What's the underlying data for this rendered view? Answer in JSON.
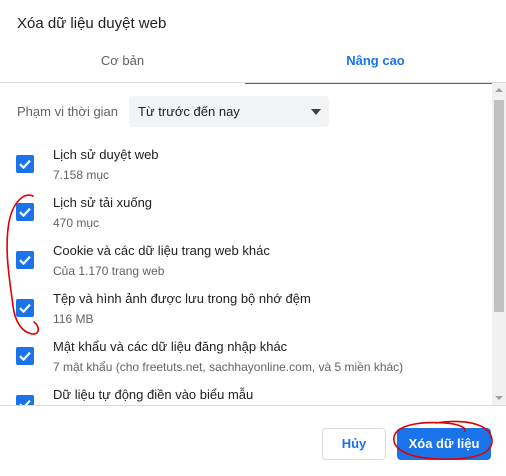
{
  "dialog": {
    "title": "Xóa dữ liệu duyệt web"
  },
  "tabs": [
    {
      "label": "Cơ bản",
      "selected": false
    },
    {
      "label": "Nâng cao",
      "selected": true
    }
  ],
  "time_range": {
    "label": "Phạm vi thời gian",
    "value": "Từ trước đến nay"
  },
  "items": [
    {
      "label": "Lịch sử duyệt web",
      "desc": "7.158 mục",
      "checked": true
    },
    {
      "label": "Lịch sử tải xuống",
      "desc": "470 mục",
      "checked": true
    },
    {
      "label": "Cookie và các dữ liệu trang web khác",
      "desc": "Của 1.170 trang web",
      "checked": true
    },
    {
      "label": "Tệp và hình ảnh được lưu trong bộ nhớ đệm",
      "desc": "116 MB",
      "checked": true
    },
    {
      "label": "Mật khẩu và các dữ liệu đăng nhập khác",
      "desc": "7 mật khẩu (cho freetuts.net, sachhayonline.com, và 5 miền khác)",
      "checked": true
    },
    {
      "label": "Dữ liệu tự động điền vào biểu mẫu",
      "desc": "",
      "checked": true
    }
  ],
  "buttons": {
    "cancel": "Hủy",
    "clear": "Xóa dữ liệu"
  },
  "colors": {
    "accent": "#1a73e8",
    "annotation": "#e00000"
  }
}
